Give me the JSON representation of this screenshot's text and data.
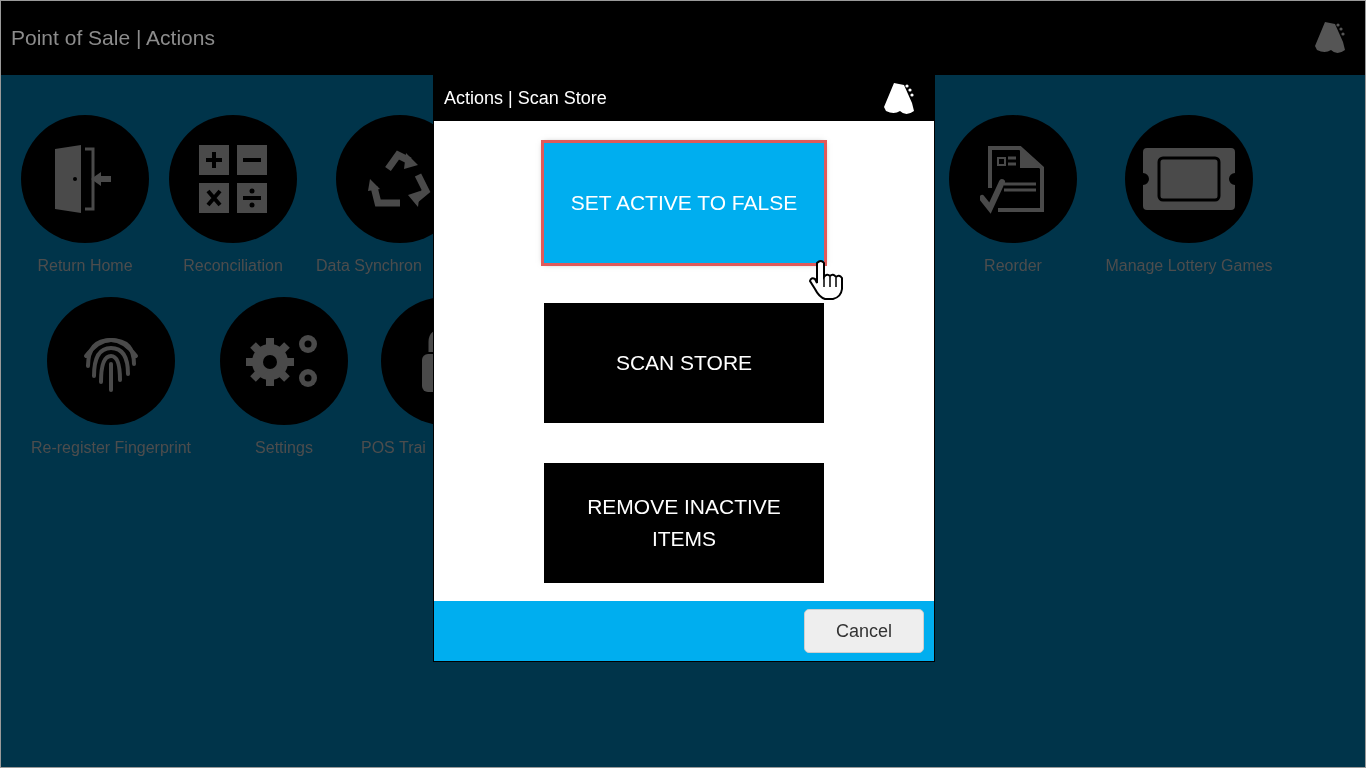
{
  "window": {
    "title": "Point of Sale | Actions"
  },
  "tile_rows": [
    [
      {
        "kind": "door",
        "label": "Return Home"
      },
      {
        "kind": "calculator",
        "label": "Reconciliation"
      },
      {
        "kind": "recycle",
        "label": "Data Synchron"
      },
      {
        "kind": "document",
        "label": "Reorder"
      },
      {
        "kind": "ticket",
        "label": "Manage Lottery Games"
      }
    ],
    [
      {
        "kind": "fingerprint",
        "label": "Re-register Fingerprint"
      },
      {
        "kind": "gears",
        "label": "Settings"
      },
      {
        "kind": "lock",
        "label": "POS Trai"
      }
    ]
  ],
  "dialog": {
    "title": "Actions | Scan Store",
    "buttons": [
      {
        "label": "SET ACTIVE TO FALSE",
        "highlighted": true
      },
      {
        "label": "SCAN STORE",
        "highlighted": false
      },
      {
        "label": "REMOVE INACTIVE ITEMS",
        "highlighted": false
      }
    ],
    "cancel": "Cancel"
  }
}
